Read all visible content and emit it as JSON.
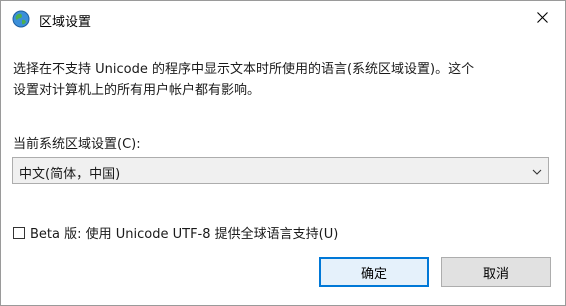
{
  "window": {
    "title": "区域设置",
    "icon": "globe-icon",
    "close_icon": "close-icon"
  },
  "description": "选择在不支持 Unicode 的程序中显示文本时所使用的语言(系统区域设置)。这个\n设置对计算机上的所有用户帐户都有影响。",
  "locale_label": "当前系统区域设置(C):",
  "locale_select": {
    "value": "中文(简体，中国)"
  },
  "beta_checkbox": {
    "label": "Beta 版: 使用 Unicode UTF-8 提供全球语言支持(U)",
    "checked": false
  },
  "buttons": {
    "ok": "确定",
    "cancel": "取消"
  },
  "colors": {
    "accent": "#0078d7",
    "button_face": "#e1e1e1",
    "combo_face": "#f0f0f0"
  }
}
